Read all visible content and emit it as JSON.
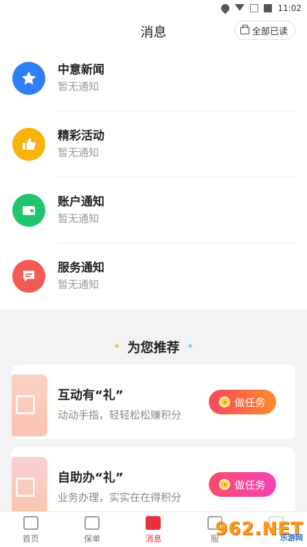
{
  "status_bar": {
    "time": "11:02"
  },
  "header": {
    "title": "消息",
    "mark_all_label": "全部已读"
  },
  "messages": [
    {
      "name": "中意新闻",
      "sub": "暂无通知",
      "icon": "star-icon",
      "color": "#2f7ef3"
    },
    {
      "name": "精彩活动",
      "sub": "暂无通知",
      "icon": "thumbs-up-icon",
      "color": "#f7b30c"
    },
    {
      "name": "账户通知",
      "sub": "暂无通知",
      "icon": "wallet-icon",
      "color": "#20c56e"
    },
    {
      "name": "服务通知",
      "sub": "暂无通知",
      "icon": "message-icon",
      "color": "#f35a54"
    }
  ],
  "recommend": {
    "title": "为您推荐",
    "cards": [
      {
        "title": "互动有“礼”",
        "sub": "动动手指，轻轻松松赚积分",
        "button": "做任务"
      },
      {
        "title": "自助办“礼”",
        "sub": "业务办理，实实在在得积分",
        "button": "做任务"
      }
    ]
  },
  "bottom_nav": [
    {
      "label": "首页",
      "icon": "home-icon",
      "active": false
    },
    {
      "label": "保单",
      "icon": "policy-icon",
      "active": false
    },
    {
      "label": "消息",
      "icon": "message-icon",
      "active": true
    },
    {
      "label": "服",
      "icon": "service-icon",
      "active": false
    },
    {
      "label": "",
      "icon": "profile-icon",
      "active": false
    }
  ],
  "watermark": {
    "text": "962.NET",
    "sub": "乐游网"
  },
  "colors": {
    "accent": "#e8303c",
    "blue": "#2f7ef3",
    "yellow": "#f7b30c",
    "green": "#20c56e",
    "red": "#f35a54"
  }
}
